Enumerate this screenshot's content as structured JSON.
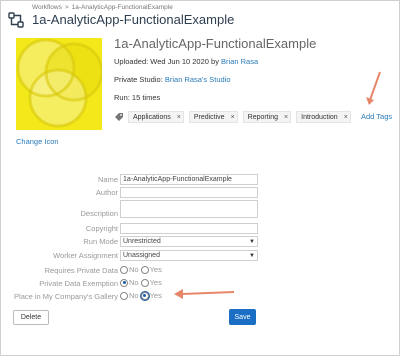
{
  "breadcrumb": {
    "root": "Workflows",
    "separator": ">",
    "current": "1a-AnalyticApp-FunctionalExample"
  },
  "page_title": "1a-AnalyticApp-FunctionalExample",
  "workflow": {
    "name": "1a-AnalyticApp-FunctionalExample",
    "uploaded_prefix": "Uploaded: Wed Jun 10 2020 by",
    "uploaded_by": "Brian Rasa",
    "studio_prefix": "Private Studio:",
    "studio_name": "Brian Rasa's Studio",
    "runs": "Run: 15 times",
    "change_icon": "Change Icon"
  },
  "tags": {
    "items": [
      {
        "label": "Applications"
      },
      {
        "label": "Predictive"
      },
      {
        "label": "Reporting"
      },
      {
        "label": "Introduction"
      }
    ],
    "remove_glyph": "×",
    "add_label": "Add Tags"
  },
  "form": {
    "name_label": "Name",
    "name_value": "1a-AnalyticApp-FunctionalExample",
    "author_label": "Author",
    "author_value": "",
    "description_label": "Description",
    "description_value": "",
    "copyright_label": "Copyright",
    "copyright_value": "",
    "runmode_label": "Run Mode",
    "runmode_value": "Unrestricted",
    "worker_label": "Worker Assignment",
    "worker_value": "Unassigned",
    "private_data_label": "Requires Private Data",
    "private_exempt_label": "Private Data Exemption",
    "gallery_label": "Place in My Company's Gallery",
    "no": "No",
    "yes": "Yes"
  },
  "buttons": {
    "delete": "Delete",
    "save": "Save"
  },
  "colors": {
    "accent": "#1a6fc4",
    "link": "#2a7ab8",
    "arrow": "#e8866a",
    "thumbnail": "#f2e81a"
  }
}
